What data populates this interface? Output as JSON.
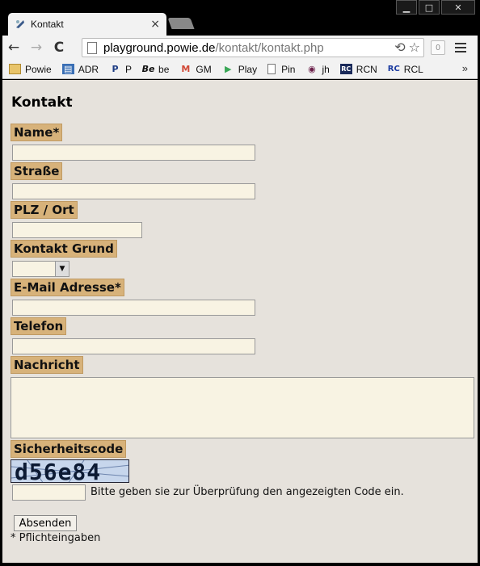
{
  "window": {
    "minimize_glyph": "▁",
    "maximize_glyph": "□",
    "close_glyph": "✕"
  },
  "tab": {
    "title": "Kontakt",
    "close_glyph": "×"
  },
  "toolbar": {
    "back_glyph": "←",
    "forward_glyph": "→",
    "reload_glyph": "C",
    "url_host": "playground.powie.de",
    "url_path": "/kontakt/kontakt.php",
    "translate_glyph": "⟲",
    "star_glyph": "☆",
    "extension_badge": "0"
  },
  "bookmarks": {
    "items": [
      {
        "label": "Powie",
        "icon": "folder-icon",
        "glyph": "",
        "color": "#e8b84a"
      },
      {
        "label": "ADR",
        "icon": "contacts-icon",
        "glyph": "▤",
        "color": "#3a6fb5"
      },
      {
        "label": "P",
        "icon": "paypal-icon",
        "glyph": "P",
        "color": "#1d3c84"
      },
      {
        "label": "be",
        "icon": "behance-icon",
        "glyph": "Be",
        "color": "#111111"
      },
      {
        "label": "GM",
        "icon": "gmail-icon",
        "glyph": "M",
        "color": "#d14836"
      },
      {
        "label": "Play",
        "icon": "play-store-icon",
        "glyph": "▶",
        "color": "#3aa757"
      },
      {
        "label": "Pin",
        "icon": "page-icon",
        "glyph": "",
        "color": "#777777"
      },
      {
        "label": "jh",
        "icon": "jh-icon",
        "glyph": "◉",
        "color": "#6b1f4a"
      },
      {
        "label": "RCN",
        "icon": "rcn-icon",
        "glyph": "RC",
        "color": "#1a2a5a"
      },
      {
        "label": "RCL",
        "icon": "rcl-icon",
        "glyph": "RC",
        "color": "#1a3aa0"
      }
    ],
    "more_glyph": "»"
  },
  "page": {
    "heading": "Kontakt",
    "fields": {
      "name_label": "Name*",
      "strasse_label": "Straße",
      "plz_ort_label": "PLZ / Ort",
      "kontakt_grund_label": "Kontakt Grund",
      "email_label": "E-Mail Adresse*",
      "telefon_label": "Telefon",
      "nachricht_label": "Nachricht",
      "sicherheitscode_label": "Sicherheitscode"
    },
    "select_arrow_glyph": "▼",
    "captcha_text": "d56e84",
    "code_hint": "Bitte geben sie zur Überprüfung den angezeigten Code ein.",
    "submit_label": "Absenden",
    "required_note": "* Pflichteingaben"
  }
}
